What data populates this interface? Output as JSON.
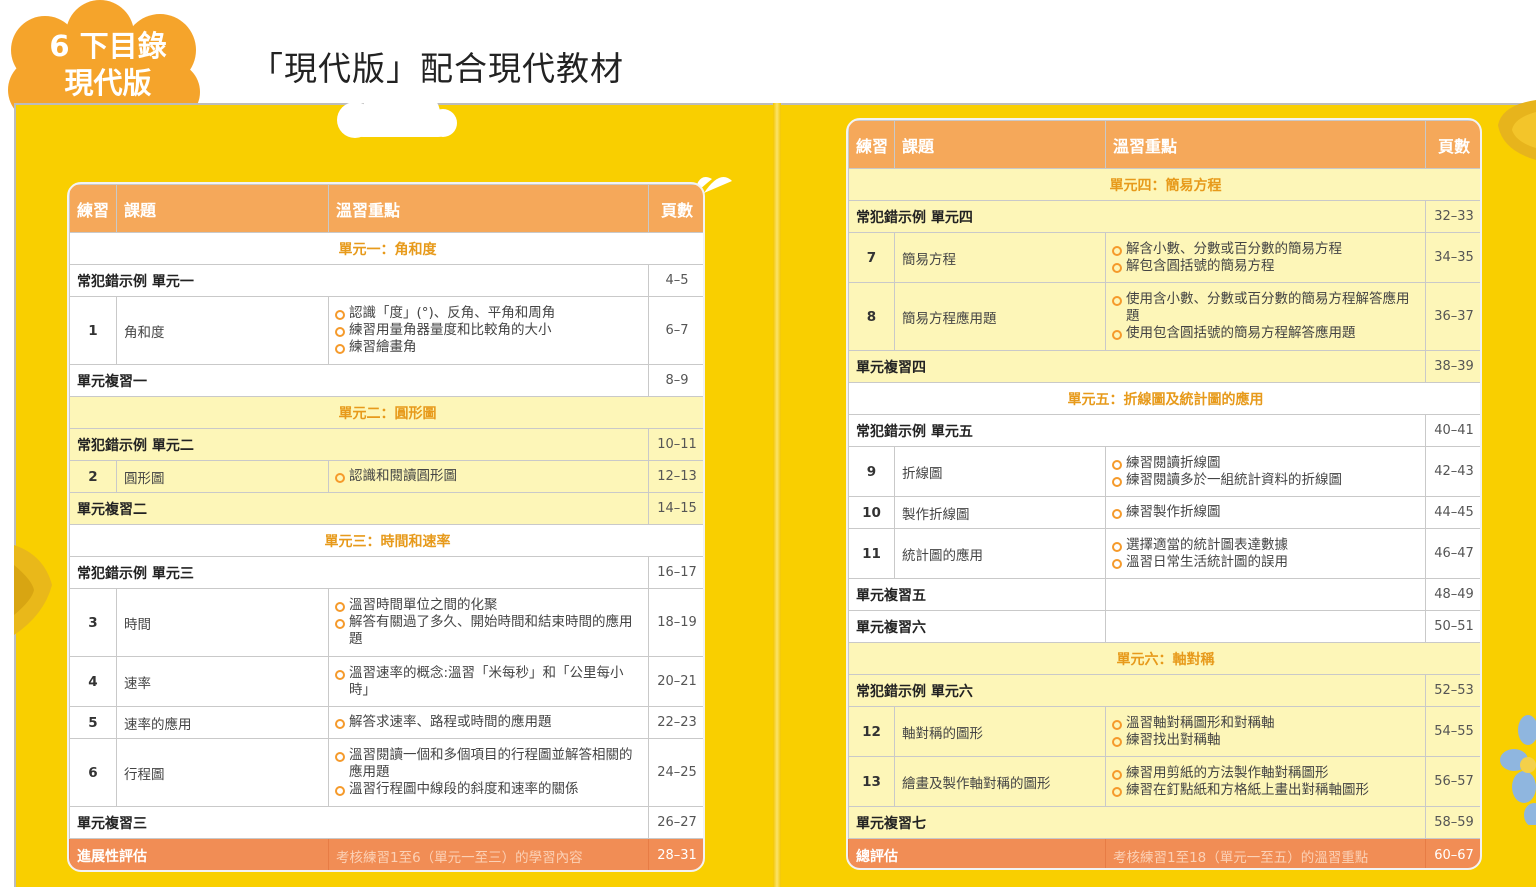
{
  "badge": {
    "line1": "6 下目錄",
    "line2": "現代版"
  },
  "title": "「現代版」配合現代教材",
  "colors": {
    "yellow": "#f9cf00",
    "orange_header": "#f5a85a",
    "unit_row": "#fdf6b8",
    "final_row": "#f18d55",
    "badge": "#f5a42b"
  },
  "headers": {
    "practice": "練習",
    "topic": "課題",
    "points": "溫習重點",
    "pages": "頁數"
  },
  "left": {
    "unit1": "單元一：角和度",
    "mist1": {
      "label": "常犯錯示例 單元一",
      "pages": "4–5"
    },
    "ex1": {
      "num": "1",
      "title": "角和度",
      "points": [
        "認識「度」(°)、反角、平角和周角",
        "練習用量角器量度和比較角的大小",
        "練習繪畫角"
      ],
      "pages": "6–7"
    },
    "rev1": {
      "label": "單元複習一",
      "pages": "8–9"
    },
    "unit2": "單元二：圓形圖",
    "mist2": {
      "label": "常犯錯示例 單元二",
      "pages": "10–11"
    },
    "ex2": {
      "num": "2",
      "title": "圓形圖",
      "points": [
        "認識和閱讀圓形圖"
      ],
      "pages": "12–13"
    },
    "rev2": {
      "label": "單元複習二",
      "pages": "14–15"
    },
    "unit3": "單元三：時間和速率",
    "mist3": {
      "label": "常犯錯示例 單元三",
      "pages": "16–17"
    },
    "ex3": {
      "num": "3",
      "title": "時間",
      "points": [
        "溫習時間單位之間的化聚",
        "解答有關過了多久、開始時間和結束時間的應用題"
      ],
      "pages": "18–19"
    },
    "ex4": {
      "num": "4",
      "title": "速率",
      "points": [
        "溫習速率的概念:溫習「米每秒」和「公里每小時」"
      ],
      "pages": "20–21"
    },
    "ex5": {
      "num": "5",
      "title": "速率的應用",
      "points": [
        "解答求速率、路程或時間的應用題"
      ],
      "pages": "22–23"
    },
    "ex6": {
      "num": "6",
      "title": "行程圖",
      "points": [
        "溫習閱讀一個和多個項目的行程圖並解答相關的應用題",
        "溫習行程圖中線段的斜度和速率的關係"
      ],
      "pages": "24–25"
    },
    "rev3": {
      "label": "單元複習三",
      "pages": "26–27"
    },
    "final": {
      "label": "進展性評估",
      "desc": "考核練習1至6（單元一至三）的學習內容",
      "pages": "28–31"
    }
  },
  "right": {
    "unit4": "單元四：簡易方程",
    "mist4": {
      "label": "常犯錯示例 單元四",
      "pages": "32–33"
    },
    "ex7": {
      "num": "7",
      "title": "簡易方程",
      "points": [
        "解含小數、分數或百分數的簡易方程",
        "解包含圓括號的簡易方程"
      ],
      "pages": "34–35"
    },
    "ex8": {
      "num": "8",
      "title": "簡易方程應用題",
      "points": [
        "使用含小數、分數或百分數的簡易方程解答應用題",
        "使用包含圓括號的簡易方程解答應用題"
      ],
      "pages": "36–37"
    },
    "rev4": {
      "label": "單元複習四",
      "pages": "38–39"
    },
    "unit5": "單元五：折線圖及統計圖的應用",
    "mist5": {
      "label": "常犯錯示例 單元五",
      "pages": "40–41"
    },
    "ex9": {
      "num": "9",
      "title": "折線圖",
      "points": [
        "練習閱讀折線圖",
        "練習閱讀多於一組統計資料的折線圖"
      ],
      "pages": "42–43"
    },
    "ex10": {
      "num": "10",
      "title": "製作折線圖",
      "points": [
        "練習製作折線圖"
      ],
      "pages": "44–45"
    },
    "ex11": {
      "num": "11",
      "title": "統計圖的應用",
      "points": [
        "選擇適當的統計圖表達數據",
        "溫習日常生活統計圖的誤用"
      ],
      "pages": "46–47"
    },
    "rev5": {
      "label": "單元複習五",
      "pages": "48–49"
    },
    "rev6": {
      "label": "單元複習六",
      "pages": "50–51"
    },
    "unit6": "單元六：軸對稱",
    "mist6": {
      "label": "常犯錯示例 單元六",
      "pages": "52–53"
    },
    "ex12": {
      "num": "12",
      "title": "軸對稱的圖形",
      "points": [
        "溫習軸對稱圖形和對稱軸",
        "練習找出對稱軸"
      ],
      "pages": "54–55"
    },
    "ex13": {
      "num": "13",
      "title": "繪畫及製作軸對稱的圖形",
      "points": [
        "練習用剪紙的方法製作軸對稱圖形",
        "練習在釘點紙和方格紙上畫出對稱軸圖形"
      ],
      "pages": "56–57"
    },
    "rev7": {
      "label": "單元複習七",
      "pages": "58–59"
    },
    "final": {
      "label": "總評估",
      "desc": "考核練習1至18（單元一至五）的溫習重點",
      "pages": "60–67"
    }
  }
}
